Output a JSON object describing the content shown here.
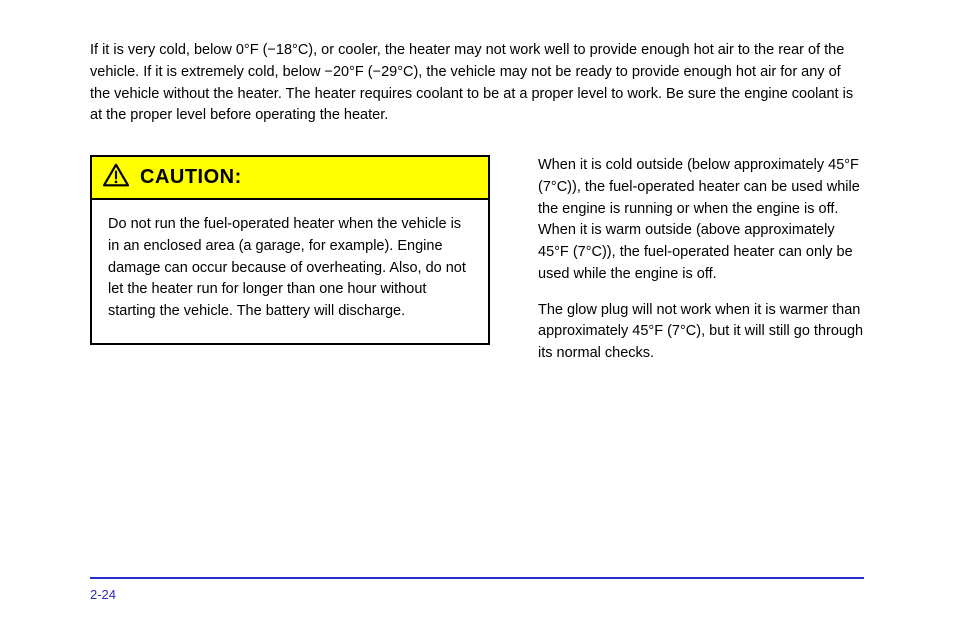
{
  "intro": "If it is very cold, below 0°F (−18°C), or cooler, the heater may not work well to provide enough hot air to the rear of the vehicle. If it is extremely cold, below −20°F (−29°C), the vehicle may not be ready to provide enough hot air for any of the vehicle without the heater. The heater requires coolant to be at a proper level to work. Be sure the engine coolant is at the proper level before operating the heater.",
  "caution": {
    "label": "CAUTION:",
    "body": "Do not run the fuel-operated heater when the vehicle is in an enclosed area (a garage, for example). Engine damage can occur because of overheating. Also, do not let the heater run for longer than one hour without starting the vehicle. The battery will discharge."
  },
  "right": {
    "p1": "When it is cold outside (below approximately 45°F (7°C)), the fuel-operated heater can be used while the engine is running or when the engine is off. When it is warm outside (above approximately 45°F (7°C)), the fuel-operated heater can only be used while the engine is off.",
    "p2": "The glow plug will not work when it is warmer than approximately 45°F (7°C), but it will still go through its normal checks."
  },
  "footer": {
    "left": "2-24",
    "right": ""
  }
}
